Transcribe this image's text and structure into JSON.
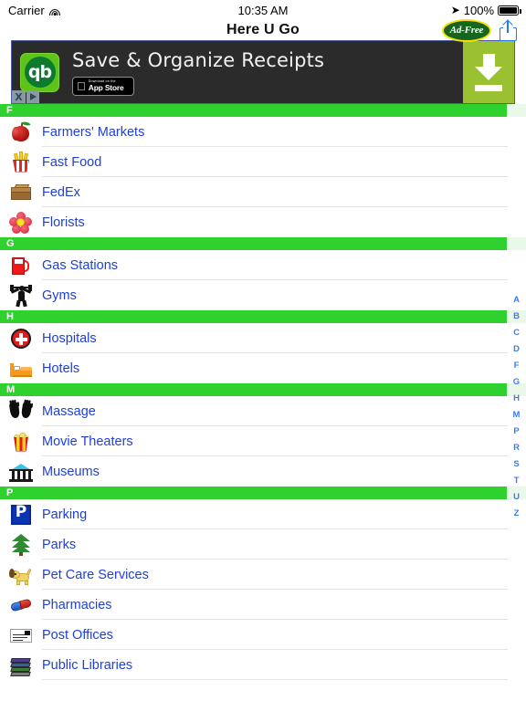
{
  "status_bar": {
    "carrier": "Carrier",
    "wifi_icon": "wifi-icon",
    "time": "10:35 AM",
    "location_arrow": "➤",
    "battery_percent": "100%",
    "battery_icon": "battery-icon"
  },
  "nav_bar": {
    "title": "Here U Go",
    "ad_free_label": "Ad-Free",
    "share_icon": "share-icon"
  },
  "ad_banner": {
    "logo_text": "qb",
    "headline": "Save & Organize Receipts",
    "appstore_line1": "Download on the",
    "appstore_line2": "App Store",
    "apple_glyph": "",
    "close_label": "X",
    "adchoices_icon": "adchoices-triangle-icon",
    "cta_icon": "download-arrow-icon",
    "cta_color": "#9ac131",
    "background": "#2b2b2b"
  },
  "list": {
    "header_color": "#2ed12e",
    "link_color": "#1f3fd8",
    "sections": [
      {
        "letter": "F",
        "rows": [
          {
            "label": "Farmers' Markets",
            "icon": "apple-icon"
          },
          {
            "label": "Fast Food",
            "icon": "fries-icon"
          },
          {
            "label": "FedEx",
            "icon": "package-box-icon"
          },
          {
            "label": "Florists",
            "icon": "flower-icon"
          }
        ]
      },
      {
        "letter": "G",
        "rows": [
          {
            "label": "Gas Stations",
            "icon": "fuel-pump-icon"
          },
          {
            "label": "Gyms",
            "icon": "weightlifter-icon"
          }
        ]
      },
      {
        "letter": "H",
        "rows": [
          {
            "label": "Hospitals",
            "icon": "medical-cross-icon"
          },
          {
            "label": "Hotels",
            "icon": "bed-icon"
          }
        ]
      },
      {
        "letter": "M",
        "rows": [
          {
            "label": "Massage",
            "icon": "hands-icon"
          },
          {
            "label": "Movie Theaters",
            "icon": "popcorn-icon"
          },
          {
            "label": "Museums",
            "icon": "classical-building-icon"
          }
        ]
      },
      {
        "letter": "P",
        "rows": [
          {
            "label": "Parking",
            "icon": "parking-sign-icon"
          },
          {
            "label": "Parks",
            "icon": "evergreen-tree-icon"
          },
          {
            "label": "Pet Care Services",
            "icon": "dog-icon"
          },
          {
            "label": "Pharmacies",
            "icon": "pill-icon"
          },
          {
            "label": "Post Offices",
            "icon": "envelope-icon"
          },
          {
            "label": "Public Libraries",
            "icon": "books-icon"
          }
        ]
      }
    ]
  },
  "section_index": {
    "letters": [
      "A",
      "B",
      "C",
      "D",
      "F",
      "G",
      "H",
      "M",
      "P",
      "R",
      "S",
      "T",
      "U",
      "Z"
    ],
    "color": "#3a7cf5"
  }
}
